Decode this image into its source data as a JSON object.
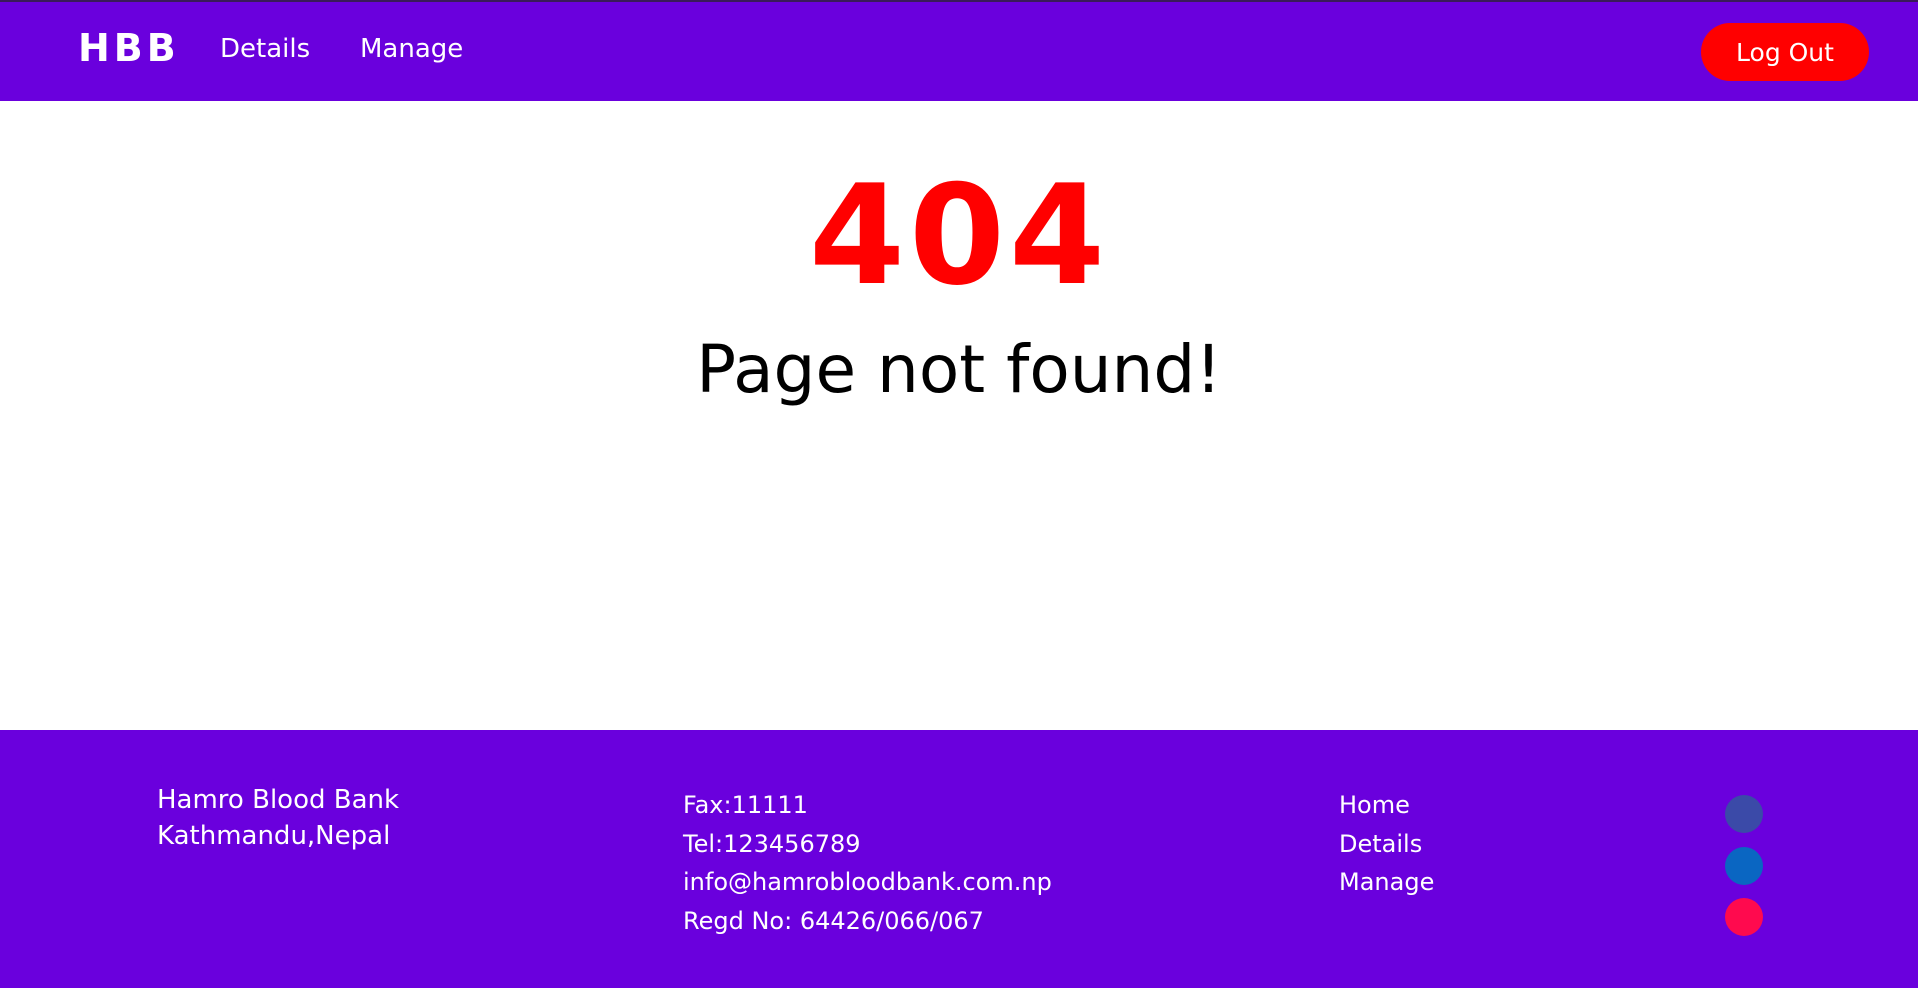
{
  "navbar": {
    "brand": "HBB",
    "links": [
      {
        "label": "Details"
      },
      {
        "label": "Manage"
      }
    ],
    "logout_label": "Log Out"
  },
  "error": {
    "code": "404",
    "message": "Page not found!"
  },
  "footer": {
    "org_lines": [
      "Hamro Blood Bank",
      "Kathmandu,Nepal"
    ],
    "contact_lines": [
      "Fax:11111",
      "Tel:123456789",
      "info@hamrobloodbank.com.np",
      "Regd No: 64426/066/067"
    ],
    "links": [
      {
        "label": "Home"
      },
      {
        "label": "Details"
      },
      {
        "label": "Manage"
      }
    ],
    "social": [
      {
        "icon": "facebook-icon",
        "color": "#3b4aa8"
      },
      {
        "icon": "linkedin-icon",
        "color": "#0a66c2"
      },
      {
        "icon": "instagram-icon",
        "color": "#ff0a4e"
      }
    ]
  },
  "colors": {
    "primary": "#6a00dd",
    "accent": "#ff0000",
    "text_on_primary": "#ffffff"
  }
}
